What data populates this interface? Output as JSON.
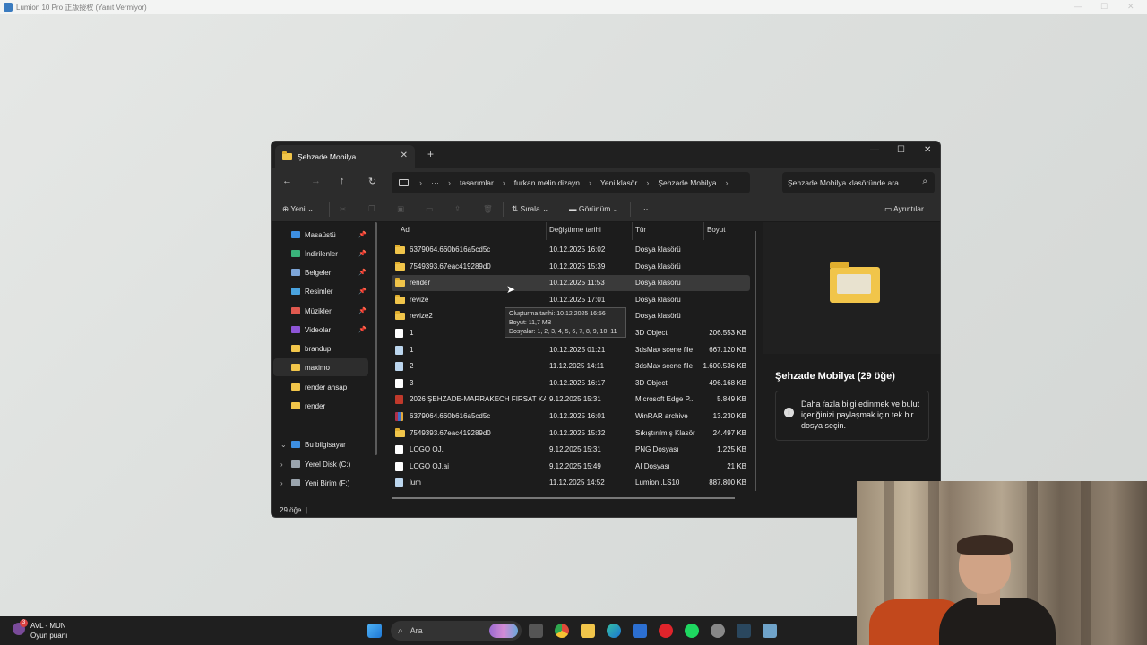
{
  "app_title": "Lumion 10 Pro 正版授权 (Yanıt Vermiyor)",
  "explorer": {
    "tab_title": "Şehzade Mobilya",
    "breadcrumb": [
      "tasarımlar",
      "furkan melin dizayn",
      "Yeni klasör",
      "Şehzade Mobilya"
    ],
    "search_placeholder": "Şehzade Mobilya klasöründe ara",
    "toolbar": {
      "new_label": "Yeni",
      "sort_label": "Sırala",
      "view_label": "Görünüm",
      "more_label": "···",
      "details_label": "Ayrıntılar"
    },
    "nav_items": [
      {
        "label": "Masaüstü",
        "pinned": true,
        "color": "#3d8ee0"
      },
      {
        "label": "İndirilenler",
        "pinned": true,
        "color": "#3ab37a"
      },
      {
        "label": "Belgeler",
        "pinned": true,
        "color": "#7ea6d8"
      },
      {
        "label": "Resimler",
        "pinned": true,
        "color": "#4aa3df"
      },
      {
        "label": "Müzikler",
        "pinned": true,
        "color": "#e0594f"
      },
      {
        "label": "Videolar",
        "pinned": true,
        "color": "#8d55d6"
      },
      {
        "label": "brandup",
        "pinned": false,
        "color": "#f1c54a"
      },
      {
        "label": "maximo",
        "pinned": false,
        "color": "#f1c54a",
        "selected": true
      },
      {
        "label": "render ahsap",
        "pinned": false,
        "color": "#f1c54a"
      },
      {
        "label": "render",
        "pinned": false,
        "color": "#f1c54a"
      },
      {
        "label": "Bu bilgisayar",
        "pinned": false,
        "color": "#3d8ee0",
        "expanded": true
      },
      {
        "label": "Yerel Disk (C:)",
        "pinned": false,
        "color": "#9aa4ad",
        "collapsed": true
      },
      {
        "label": "Yeni Birim (F:)",
        "pinned": false,
        "color": "#9aa4ad",
        "collapsed": true
      }
    ],
    "columns": {
      "name": "Ad",
      "date": "Değiştirme tarihi",
      "type": "Tür",
      "size": "Boyut"
    },
    "rows": [
      {
        "name": "6379064.660b616a5cd5c",
        "date": "10.12.2025 16:02",
        "type": "Dosya klasörü",
        "size": "",
        "icon": "folder"
      },
      {
        "name": "7549393.67eac419289d0",
        "date": "10.12.2025 15:39",
        "type": "Dosya klasörü",
        "size": "",
        "icon": "folder"
      },
      {
        "name": "render",
        "date": "10.12.2025 11:53",
        "type": "Dosya klasörü",
        "size": "",
        "icon": "folder",
        "hover": true
      },
      {
        "name": "revize",
        "date": "10.12.2025 17:01",
        "type": "Dosya klasörü",
        "size": "",
        "icon": "folder"
      },
      {
        "name": "revize2",
        "date": "",
        "type": "Dosya klasörü",
        "size": "",
        "icon": "folder"
      },
      {
        "name": "1",
        "date": "",
        "type": "3D Object",
        "size": "206.553 KB",
        "icon": "file"
      },
      {
        "name": "1",
        "date": "10.12.2025 01:21",
        "type": "3dsMax scene file",
        "size": "667.120 KB",
        "icon": "blue"
      },
      {
        "name": "2",
        "date": "11.12.2025 14:11",
        "type": "3dsMax scene file",
        "size": "1.600.536 KB",
        "icon": "blue"
      },
      {
        "name": "3",
        "date": "10.12.2025 16:17",
        "type": "3D Object",
        "size": "496.168 KB",
        "icon": "file"
      },
      {
        "name": "2026 ŞEHZADE-MARRAKECH FIRSAT KAT...",
        "date": "9.12.2025 15:31",
        "type": "Microsoft Edge P...",
        "size": "5.849 KB",
        "icon": "red"
      },
      {
        "name": "6379064.660b616a5cd5c",
        "date": "10.12.2025 16:01",
        "type": "WinRAR archive",
        "size": "13.230 KB",
        "icon": "multi"
      },
      {
        "name": "7549393.67eac419289d0",
        "date": "10.12.2025 15:32",
        "type": "Sıkıştırılmış Klasör",
        "size": "24.497 KB",
        "icon": "folder"
      },
      {
        "name": "LOGO OJ.",
        "date": "9.12.2025 15:31",
        "type": "PNG Dosyası",
        "size": "1.225 KB",
        "icon": "file"
      },
      {
        "name": "LOGO OJ.ai",
        "date": "9.12.2025 15:49",
        "type": "AI Dosyası",
        "size": "21 KB",
        "icon": "file"
      },
      {
        "name": "lum",
        "date": "11.12.2025 14:52",
        "type": "Lumion .LS10",
        "size": "887.800 KB",
        "icon": "blue"
      }
    ],
    "tooltip": {
      "line1": "Oluşturma tarihi: 10.12.2025 16:56",
      "line2": "Boyut: 11,7 MB",
      "line3": "Dosyalar: 1, 2, 3, 4, 5, 6, 7, 8, 9, 10, 11"
    },
    "details_pane": {
      "title": "Şehzade Mobilya (29 öğe)",
      "info": "Daha fazla bilgi edinmek ve bulut içeriğinizi paylaşmak için tek bir dosya seçin."
    },
    "status": "29 öğe"
  },
  "taskbar": {
    "weather_line1": "AVL - MUN",
    "weather_line2": "Oyun puanı",
    "weather_badge": "3",
    "search_label": "Ara"
  }
}
